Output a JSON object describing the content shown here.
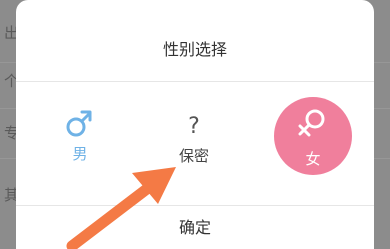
{
  "background": {
    "row_chars": [
      "出",
      "个",
      "专",
      "其"
    ]
  },
  "dialog": {
    "title": "性别选择",
    "options": {
      "male": {
        "label": "男",
        "icon": "male-symbol-icon"
      },
      "secret": {
        "symbol": "?",
        "label": "保密"
      },
      "female": {
        "label": "女",
        "icon": "female-symbol-icon",
        "selected": true
      }
    },
    "confirm_label": "确定"
  },
  "colors": {
    "male": "#6fb2e6",
    "female": "#f07f9c",
    "arrow": "#f47a45"
  }
}
